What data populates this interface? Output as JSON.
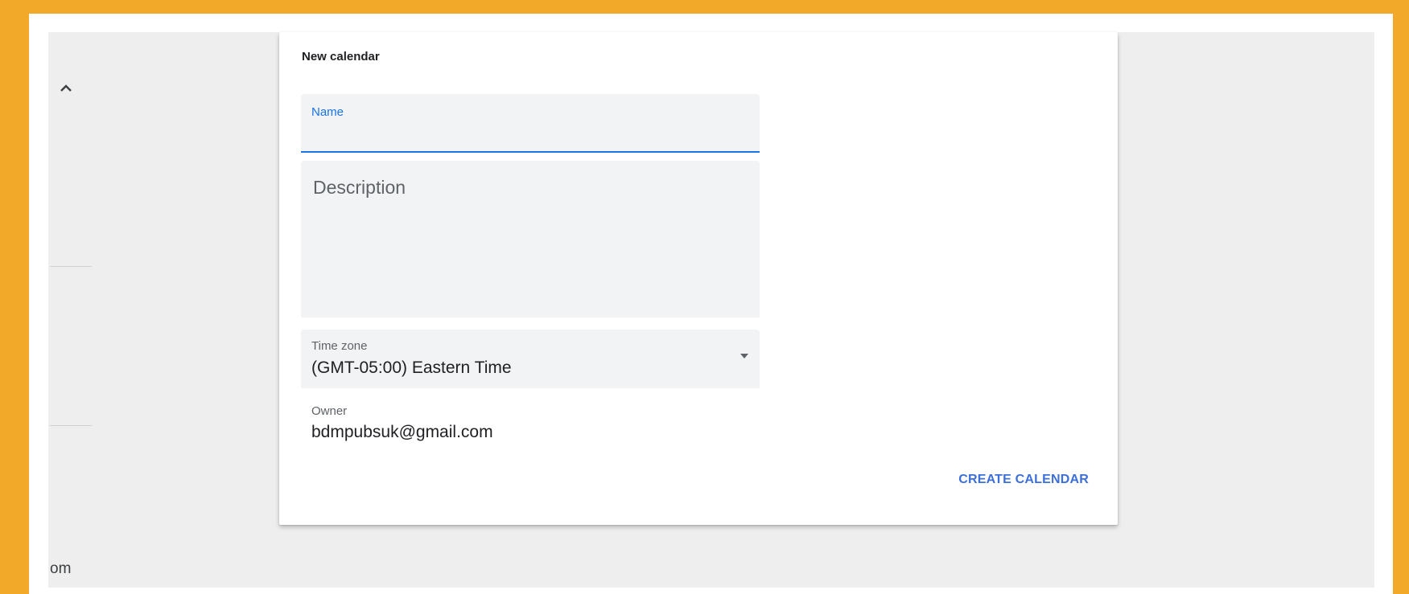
{
  "dialog": {
    "title": "New calendar",
    "name_label": "Name",
    "name_value": "",
    "description_placeholder": "Description",
    "timezone_label": "Time zone",
    "timezone_value": "(GMT-05:00) Eastern Time",
    "owner_label": "Owner",
    "owner_value": "bdmpubsuk@gmail.com",
    "create_button": "CREATE CALENDAR"
  },
  "left_panel": {
    "truncated_text": "om",
    "collapse_icon": "chevron-up-icon"
  },
  "colors": {
    "frame": "#f2a92a",
    "accent": "#1a73e8",
    "button_text": "#3c6fd8",
    "field_background": "#f1f3f4"
  }
}
